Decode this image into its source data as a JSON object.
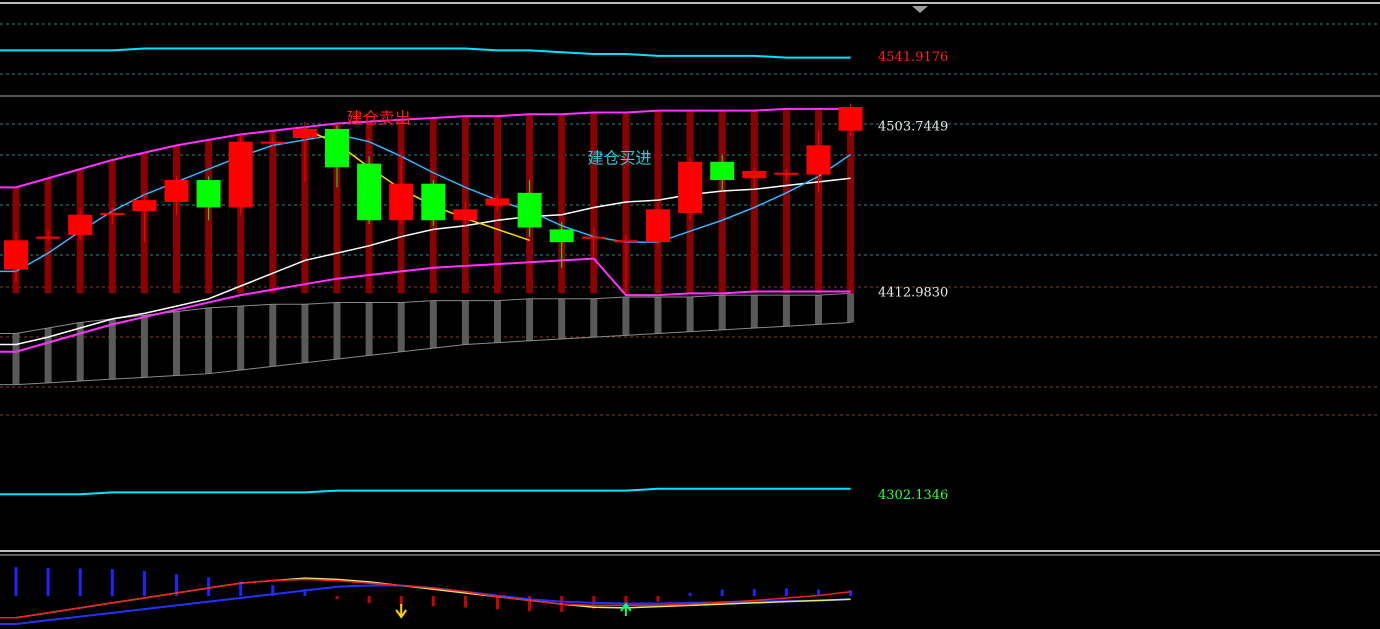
{
  "colors": {
    "background": "#000000",
    "up": "#ff0000",
    "down": "#00ff00",
    "channel": "#ff33ff",
    "band_outer": "#00e5ff",
    "ma_short": "#33b5ff",
    "ma_long": "#ffffff",
    "signal_line": "#ffd400",
    "hist_dark_red": "#8b0000",
    "hist_gray": "#5a5a5a",
    "grid_teal": "#2a8a8a",
    "grid_brown": "#8a3a2a",
    "arrow_sell": "#ffd400",
    "arrow_buy": "#00ff66"
  },
  "chart_data": {
    "type": "candlestick",
    "x": [
      1,
      2,
      3,
      4,
      5,
      6,
      7,
      8,
      9,
      10,
      11,
      12,
      13,
      14,
      15,
      16,
      17,
      18,
      19,
      20,
      21,
      22,
      23,
      24,
      25,
      26,
      27
    ],
    "ylim": [
      4280,
      4560
    ],
    "price_labels": [
      {
        "text": "4541.9176",
        "value": 4541.9176,
        "color": "#ff2020"
      },
      {
        "text": "4503.7449",
        "value": 4503.7449,
        "color": "#e6e6e6"
      },
      {
        "text": "4412.9830",
        "value": 4412.983,
        "color": "#e6e6e6"
      },
      {
        "text": "4302.1346",
        "value": 4302.1346,
        "color": "#33ff33"
      }
    ],
    "candles": [
      {
        "open": 4425,
        "close": 4441,
        "high": 4445,
        "low": 4418
      },
      {
        "open": 4443,
        "close": 4443,
        "high": 4447,
        "low": 4440
      },
      {
        "open": 4444,
        "close": 4455,
        "high": 4458,
        "low": 4441
      },
      {
        "open": 4456,
        "close": 4456,
        "high": 4459,
        "low": 4450
      },
      {
        "open": 4457,
        "close": 4463,
        "high": 4466,
        "low": 4440
      },
      {
        "open": 4462,
        "close": 4474,
        "high": 4476,
        "low": 4455
      },
      {
        "open": 4474,
        "close": 4459,
        "high": 4476,
        "low": 4452
      },
      {
        "open": 4459,
        "close": 4495,
        "high": 4498,
        "low": 4455
      },
      {
        "open": 4495,
        "close": 4495,
        "high": 4498,
        "low": 4492
      },
      {
        "open": 4497,
        "close": 4502,
        "high": 4506,
        "low": 4473
      },
      {
        "open": 4502,
        "close": 4481,
        "high": 4504,
        "low": 4470
      },
      {
        "open": 4483,
        "close": 4452,
        "high": 4487,
        "low": 4450
      },
      {
        "open": 4452,
        "close": 4472,
        "high": 4490,
        "low": 4450
      },
      {
        "open": 4472,
        "close": 4452,
        "high": 4474,
        "low": 4449
      },
      {
        "open": 4452,
        "close": 4458,
        "high": 4462,
        "low": 4449
      },
      {
        "open": 4460,
        "close": 4464,
        "high": 4466,
        "low": 4457
      },
      {
        "open": 4467,
        "close": 4448,
        "high": 4474,
        "low": 4443
      },
      {
        "open": 4447,
        "close": 4440,
        "high": 4451,
        "low": 4426
      },
      {
        "open": 4443,
        "close": 4443,
        "high": 4448,
        "low": 4432
      },
      {
        "open": 4441,
        "close": 4441,
        "high": 4444,
        "low": 4413
      },
      {
        "open": 4440,
        "close": 4458,
        "high": 4461,
        "low": 4438
      },
      {
        "open": 4456,
        "close": 4484,
        "high": 4486,
        "low": 4452
      },
      {
        "open": 4484,
        "close": 4474,
        "high": 4488,
        "low": 4468
      },
      {
        "open": 4475,
        "close": 4479,
        "high": 4481,
        "low": 4470
      },
      {
        "open": 4478,
        "close": 4478,
        "high": 4480,
        "low": 4474
      },
      {
        "open": 4477,
        "close": 4493,
        "high": 4501,
        "low": 4467
      },
      {
        "open": 4501,
        "close": 4514,
        "high": 4516,
        "low": 4498
      }
    ],
    "ma_short": [
      4424,
      4434,
      4446,
      4457,
      4466,
      4473,
      4480,
      4487,
      4493,
      4496,
      4499,
      4495,
      4487,
      4478,
      4470,
      4463,
      4457,
      4449,
      4443,
      4440,
      4440,
      4446,
      4452,
      4459,
      4467,
      4476,
      4488
    ],
    "ma_long": [
      4384,
      4388,
      4393,
      4398,
      4401,
      4405,
      4409,
      4416,
      4423,
      4430,
      4434,
      4438,
      4443,
      4447,
      4449,
      4452,
      4454,
      4455,
      4459,
      4462,
      4463,
      4466,
      4468,
      4469,
      4471,
      4473,
      4475
    ],
    "signal_line": {
      "start": 10,
      "values": [
        4502,
        4494,
        4481,
        4469,
        4460,
        4453,
        4447,
        4441
      ]
    },
    "channel_upper": [
      4470,
      4475,
      4480,
      4485,
      4489,
      4493,
      4496,
      4499,
      4501,
      4503,
      4505,
      4506,
      4507,
      4508,
      4509,
      4509,
      4510,
      4510,
      4511,
      4511,
      4512,
      4512,
      4512,
      4512,
      4513,
      4513,
      4513
    ],
    "channel_lower": [
      4380,
      4385,
      4390,
      4395,
      4399,
      4403,
      4407,
      4411,
      4414,
      4417,
      4420,
      4422,
      4424,
      4426,
      4427,
      4428,
      4429,
      4430,
      4431,
      4411,
      4411,
      4412,
      4412,
      4413,
      4413,
      4413,
      4413
    ],
    "band_upper": [
      4545,
      4545,
      4545,
      4545,
      4546,
      4546,
      4546,
      4546,
      4546,
      4546,
      4546,
      4546,
      4546,
      4546,
      4546,
      4545,
      4545,
      4544,
      4543,
      4543,
      4542,
      4542,
      4542,
      4542,
      4541,
      4541,
      4541
    ],
    "band_lower": [
      4302,
      4302,
      4302,
      4303,
      4303,
      4303,
      4303,
      4303,
      4303,
      4303,
      4304,
      4304,
      4304,
      4304,
      4304,
      4304,
      4304,
      4304,
      4304,
      4304,
      4305,
      4305,
      4305,
      4305,
      4305,
      4305,
      4305
    ],
    "red_bars": {
      "base": 4412,
      "tops": [
        4470,
        4475,
        4480,
        4485,
        4489,
        4493,
        4496,
        4499,
        4501,
        4503,
        4505,
        4506,
        4507,
        4508,
        4509,
        4509,
        4510,
        4510,
        4511,
        4511,
        4512,
        4512,
        4512,
        4512,
        4513,
        4513,
        4513
      ]
    },
    "gray_bars": {
      "tops": [
        4390,
        4393,
        4396,
        4398,
        4400,
        4402,
        4404,
        4405,
        4406,
        4406,
        4407,
        4407,
        4407,
        4408,
        4408,
        4408,
        4409,
        4409,
        4409,
        4410,
        4410,
        4410,
        4411,
        4411,
        4411,
        4411,
        4412
      ],
      "bottoms": [
        4362,
        4363,
        4364,
        4365,
        4366,
        4367,
        4368,
        4370,
        4372,
        4374,
        4376,
        4378,
        4380,
        4382,
        4384,
        4385,
        4386,
        4387,
        4388,
        4389,
        4390,
        4391,
        4392,
        4393,
        4394,
        4395,
        4396
      ]
    },
    "annotations": [
      {
        "text": "建仓卖出",
        "x": 12.3,
        "y": 4505,
        "color": "#ff2020"
      },
      {
        "text": "建仓买进",
        "x": 19.8,
        "y": 4483,
        "color": "#33c5d8"
      }
    ],
    "sub_panel": {
      "ylim": [
        0,
        1
      ],
      "line_red": [
        0.1,
        0.18,
        0.26,
        0.34,
        0.42,
        0.5,
        0.58,
        0.66,
        0.7,
        0.72,
        0.7,
        0.66,
        0.62,
        0.58,
        0.52,
        0.44,
        0.38,
        0.32,
        0.3,
        0.3,
        0.3,
        0.32,
        0.35,
        0.38,
        0.42,
        0.46,
        0.52
      ],
      "line_yellow": [
        0.1,
        0.18,
        0.26,
        0.34,
        0.42,
        0.5,
        0.58,
        0.66,
        0.7,
        0.74,
        0.72,
        0.68,
        0.62,
        0.56,
        0.5,
        0.44,
        0.38,
        0.32,
        0.27,
        0.26,
        0.28,
        0.3,
        0.32,
        0.34,
        0.36,
        0.38,
        0.4
      ],
      "line_blue": [
        0.0,
        0.06,
        0.12,
        0.18,
        0.24,
        0.3,
        0.36,
        0.42,
        0.48,
        0.54,
        0.6,
        0.62,
        0.62,
        0.58,
        0.52,
        0.46,
        0.4,
        0.36,
        0.34,
        0.33,
        0.33,
        0.34,
        0.35,
        0.36,
        0.37,
        0.38,
        0.4
      ],
      "bars": [
        0.9,
        0.88,
        0.86,
        0.84,
        0.78,
        0.68,
        0.58,
        0.46,
        0.34,
        0.22,
        -0.1,
        -0.22,
        -0.3,
        -0.32,
        -0.36,
        -0.42,
        -0.48,
        -0.5,
        -0.4,
        -0.3,
        -0.18,
        0.1,
        0.2,
        0.22,
        0.24,
        0.2,
        0.18
      ],
      "arrows": [
        {
          "x": 13,
          "direction": "down",
          "color": "#ffd400"
        },
        {
          "x": 20,
          "direction": "up",
          "color": "#00ff66"
        }
      ]
    }
  }
}
